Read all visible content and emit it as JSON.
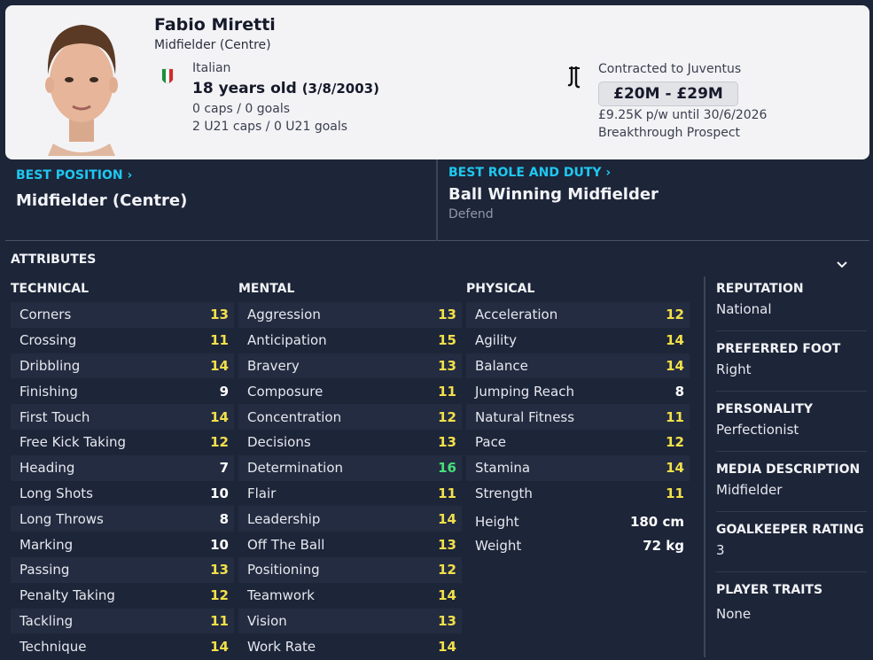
{
  "player": {
    "name": "Fabio Miretti",
    "position": "Midfielder (Centre)",
    "nationality": "Italian",
    "age": "18 years old",
    "dob": "(3/8/2003)",
    "caps": "0 caps / 0 goals",
    "u21_caps": "2 U21 caps / 0 U21 goals"
  },
  "contract": {
    "label": "Contracted to Juventus",
    "value": "£20M - £29M",
    "wage": "£9.25K p/w until 30/6/2026",
    "status": "Breakthrough Prospect"
  },
  "best_position": {
    "title": "BEST POSITION",
    "value": "Midfielder (Centre)"
  },
  "best_role": {
    "title": "BEST ROLE AND DUTY",
    "value": "Ball Winning Midfielder",
    "duty": "Defend"
  },
  "attributes_title": "ATTRIBUTES",
  "technical": {
    "title": "TECHNICAL",
    "rows": [
      {
        "label": "Corners",
        "value": "13"
      },
      {
        "label": "Crossing",
        "value": "11"
      },
      {
        "label": "Dribbling",
        "value": "14"
      },
      {
        "label": "Finishing",
        "value": "9"
      },
      {
        "label": "First Touch",
        "value": "14"
      },
      {
        "label": "Free Kick Taking",
        "value": "12"
      },
      {
        "label": "Heading",
        "value": "7"
      },
      {
        "label": "Long Shots",
        "value": "10"
      },
      {
        "label": "Long Throws",
        "value": "8"
      },
      {
        "label": "Marking",
        "value": "10"
      },
      {
        "label": "Passing",
        "value": "13"
      },
      {
        "label": "Penalty Taking",
        "value": "12"
      },
      {
        "label": "Tackling",
        "value": "11"
      },
      {
        "label": "Technique",
        "value": "14"
      }
    ]
  },
  "mental": {
    "title": "MENTAL",
    "rows": [
      {
        "label": "Aggression",
        "value": "13"
      },
      {
        "label": "Anticipation",
        "value": "15"
      },
      {
        "label": "Bravery",
        "value": "13"
      },
      {
        "label": "Composure",
        "value": "11"
      },
      {
        "label": "Concentration",
        "value": "12"
      },
      {
        "label": "Decisions",
        "value": "13"
      },
      {
        "label": "Determination",
        "value": "16"
      },
      {
        "label": "Flair",
        "value": "11"
      },
      {
        "label": "Leadership",
        "value": "14"
      },
      {
        "label": "Off The Ball",
        "value": "13"
      },
      {
        "label": "Positioning",
        "value": "12"
      },
      {
        "label": "Teamwork",
        "value": "14"
      },
      {
        "label": "Vision",
        "value": "13"
      },
      {
        "label": "Work Rate",
        "value": "14"
      }
    ]
  },
  "physical": {
    "title": "PHYSICAL",
    "rows": [
      {
        "label": "Acceleration",
        "value": "12"
      },
      {
        "label": "Agility",
        "value": "14"
      },
      {
        "label": "Balance",
        "value": "14"
      },
      {
        "label": "Jumping Reach",
        "value": "8"
      },
      {
        "label": "Natural Fitness",
        "value": "11"
      },
      {
        "label": "Pace",
        "value": "12"
      },
      {
        "label": "Stamina",
        "value": "14"
      },
      {
        "label": "Strength",
        "value": "11"
      }
    ],
    "height_label": "Height",
    "height": "180 cm",
    "weight_label": "Weight",
    "weight": "72 kg"
  },
  "info": {
    "reputation_label": "REPUTATION",
    "reputation": "National",
    "foot_label": "PREFERRED FOOT",
    "foot": "Right",
    "personality_label": "PERSONALITY",
    "personality": "Perfectionist",
    "media_label": "MEDIA DESCRIPTION",
    "media": "Midfielder",
    "gk_label": "GOALKEEPER RATING",
    "gk": "3",
    "traits_label": "PLAYER TRAITS",
    "traits": "None"
  },
  "colors": {
    "accent": "#1ec8f0",
    "value_high": "#f2e04a",
    "value_top": "#47e07a",
    "background": "#1d2539"
  }
}
